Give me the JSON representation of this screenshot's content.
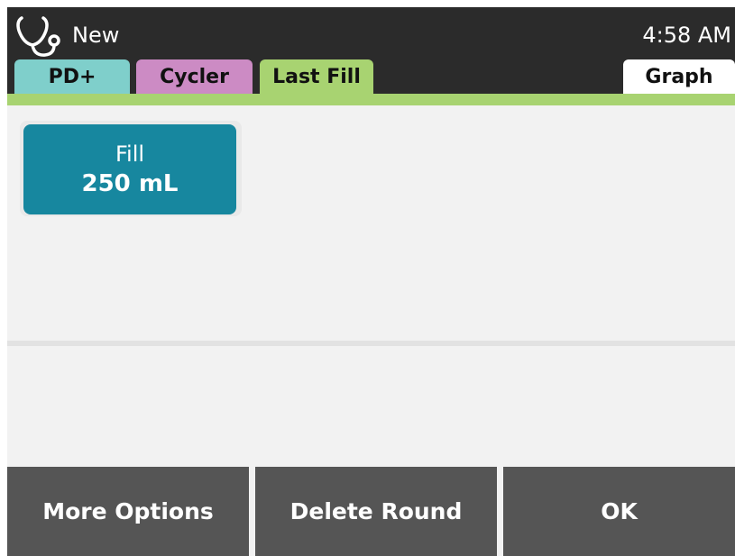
{
  "header": {
    "title": "New",
    "clock": "4:58 AM",
    "icon": "stethoscope-icon"
  },
  "tabs": [
    {
      "label": "PD+",
      "color": "#7fcfcb"
    },
    {
      "label": "Cycler",
      "color": "#cc8bc4"
    },
    {
      "label": "Last Fill",
      "color": "#a8d371",
      "active": true
    },
    {
      "label": "Graph",
      "color": "#ffffff"
    }
  ],
  "fill": {
    "label": "Fill",
    "value": "250 mL",
    "color": "#17879f"
  },
  "footer": {
    "more_options": "More Options",
    "delete_round": "Delete Round",
    "ok": "OK"
  }
}
